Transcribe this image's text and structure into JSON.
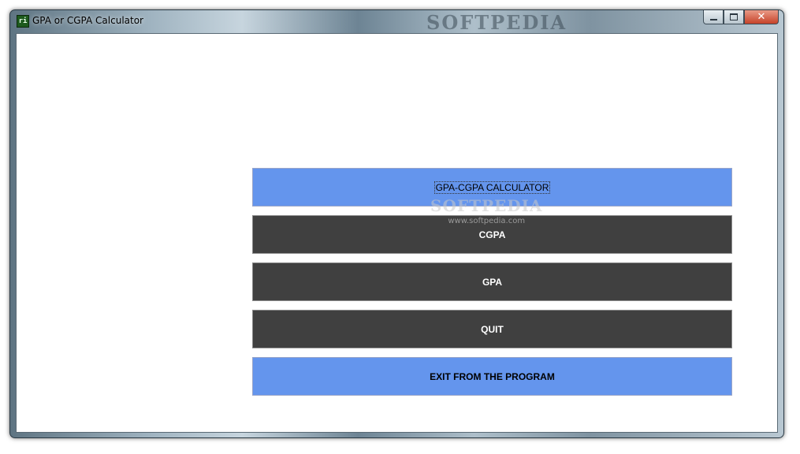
{
  "window": {
    "title": "GPA or CGPA Calculator",
    "icon_label": "ri",
    "banner_text": "SOFTPEDIA",
    "controls": {
      "minimize_icon": "minimize-icon",
      "maximize_icon": "maximize-icon",
      "close_glyph": "✕"
    }
  },
  "menu": {
    "header_label": "GPA-CGPA CALCULATOR",
    "cgpa_label": "CGPA",
    "gpa_label": "GPA",
    "quit_label": "QUIT",
    "exit_label": "EXIT FROM THE PROGRAM"
  },
  "watermark": {
    "brand": "SOFTPEDIA",
    "url": "www.softpedia.com"
  },
  "colors": {
    "accent_blue": "#6495ed",
    "dark_button": "#404040"
  }
}
